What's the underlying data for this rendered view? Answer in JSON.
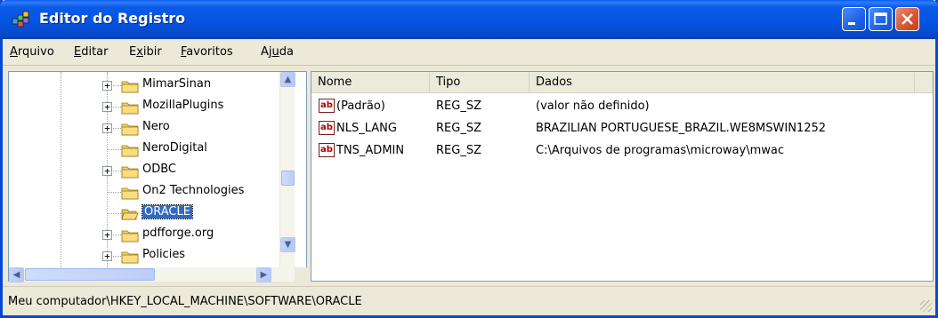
{
  "window": {
    "title": "Editor do Registro",
    "accent": "#0553e0",
    "close_color": "#d9532f"
  },
  "menu": [
    {
      "label": "Arquivo",
      "hotkey": "A"
    },
    {
      "label": "Editar",
      "hotkey": "E"
    },
    {
      "label": "Exibir",
      "hotkey": "x"
    },
    {
      "label": "Favoritos",
      "hotkey": "F"
    },
    {
      "label": "Ajuda",
      "hotkey": "u"
    }
  ],
  "tree": {
    "items": [
      {
        "label": "MimarSinan",
        "expandable": true,
        "expander": "+"
      },
      {
        "label": "MozillaPlugins",
        "expandable": true,
        "expander": "+"
      },
      {
        "label": "Nero",
        "expandable": true,
        "expander": "+"
      },
      {
        "label": "NeroDigital",
        "expandable": false
      },
      {
        "label": "ODBC",
        "expandable": true,
        "expander": "+"
      },
      {
        "label": "On2 Technologies",
        "expandable": false
      },
      {
        "label": "ORACLE",
        "expandable": false,
        "selected": true,
        "open": true
      },
      {
        "label": "pdfforge.org",
        "expandable": true,
        "expander": "+"
      },
      {
        "label": "Policies",
        "expandable": true,
        "expander": "+"
      }
    ],
    "scroll_position": 0.62
  },
  "list": {
    "columns": [
      "Nome",
      "Tipo",
      "Dados"
    ],
    "rows": [
      {
        "name": "(Padrão)",
        "type": "REG_SZ",
        "data": "(valor não definido)",
        "icon": "ab"
      },
      {
        "name": "NLS_LANG",
        "type": "REG_SZ",
        "data": "BRAZILIAN PORTUGUESE_BRAZIL.WE8MSWIN1252",
        "icon": "ab"
      },
      {
        "name": "TNS_ADMIN",
        "type": "REG_SZ",
        "data": "C:\\Arquivos de programas\\microway\\mwac",
        "icon": "ab"
      }
    ]
  },
  "status": {
    "path": "Meu computador\\HKEY_LOCAL_MACHINE\\SOFTWARE\\ORACLE"
  }
}
